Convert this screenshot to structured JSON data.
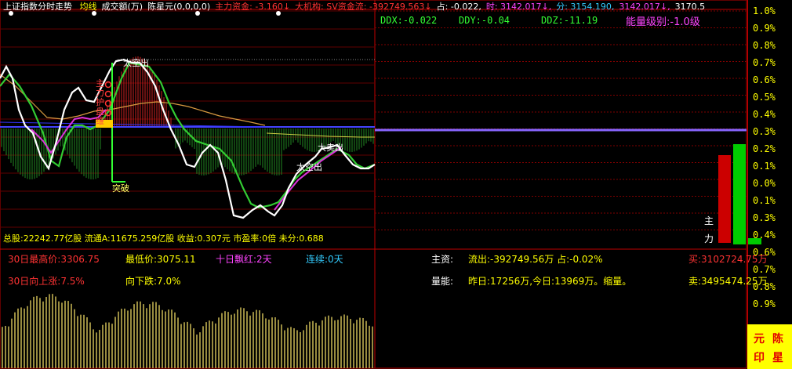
{
  "header": {
    "title": "上证指数分时走势",
    "items": [
      {
        "text": "均线",
        "color": "#ffff00"
      },
      {
        "text": "成交额(万)",
        "color": "#ffffff"
      },
      {
        "text": "陈星元(0,0,0,0)",
        "color": "#ffffff"
      },
      {
        "text": "主力资金: -3.160↓",
        "color": "#ff3333"
      },
      {
        "text": "大机构: SV资金流: -392749.563↓",
        "color": "#ff3333"
      },
      {
        "text": "占: -0.022,",
        "color": "#ffffff"
      },
      {
        "text": "时: 3142.017↓,",
        "color": "#ff44ff"
      },
      {
        "text": "分: 3154.190,",
        "color": "#33ccff"
      },
      {
        "text": "3142.017↓,",
        "color": "#ff44ff"
      },
      {
        "text": "3170.5",
        "color": "#ffffff"
      }
    ]
  },
  "ddx": {
    "ddx": "DDX:-0.022",
    "ddy": "DDY:-0.04",
    "ddz": "DDZ:-11.19",
    "level": "能量级别:-1.0级"
  },
  "annotations": {
    "peak_label": "太空出",
    "breakthrough": "突破",
    "zhu": "主",
    "li": "力",
    "sell1": "大卖出",
    "sell2": "太空出",
    "left_tags": [
      "主",
      "力",
      "护",
      "盘",
      "维"
    ]
  },
  "right_axis": [
    "1.0%",
    "0.9%",
    "0.8%",
    "0.7%",
    "0.6%",
    "0.5%",
    "0.4%",
    "0.3%",
    "0.2%",
    "0.1%",
    "0.0%",
    "0.1%",
    "0.3%",
    "0.4%",
    "0.6%",
    "0.7%",
    "0.8%",
    "0.9%"
  ],
  "zhuli_label": [
    "主",
    "力"
  ],
  "info": {
    "line1": "总股:22242.77亿股 流通A:11675.259亿股 收益:0.307元 市盈率:0倍 未分:0.688",
    "hi30": "30日最高价:3306.75",
    "low": "最低价:3075.11",
    "red10": "十日飘红:2天",
    "streak": "连续:0天",
    "up30": "30日向上涨:7.5%",
    "down": "向下跌:7.0%",
    "zhuzi_label": "主资:",
    "outflow": "流出:-392749.56万 占:-0.02%",
    "buy": "买:3102724.75万",
    "volume_label": "量能:",
    "volume": "昨日:17256万,今日:13969万。缩量。",
    "sell": "卖:3495474.25万"
  },
  "stamp": [
    "元",
    "陈",
    "印",
    "星"
  ]
}
